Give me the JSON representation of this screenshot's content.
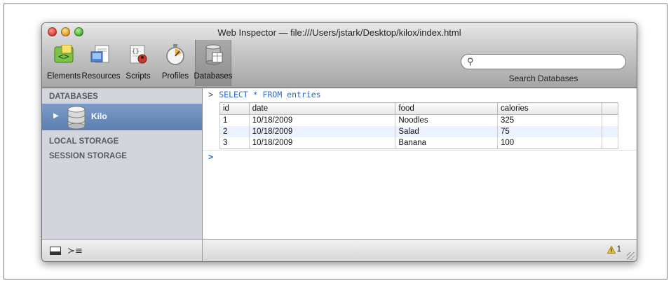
{
  "window": {
    "title": "Web Inspector — file:///Users/jstark/Desktop/kilox/index.html"
  },
  "toolbar": {
    "items": [
      {
        "label": "Elements",
        "icon": "elements-icon"
      },
      {
        "label": "Resources",
        "icon": "resources-icon"
      },
      {
        "label": "Scripts",
        "icon": "scripts-icon"
      },
      {
        "label": "Profiles",
        "icon": "profiles-icon"
      },
      {
        "label": "Databases",
        "icon": "databases-icon",
        "active": true
      }
    ],
    "search_label": "Search Databases"
  },
  "sidebar": {
    "databases_header": "DATABASES",
    "selected_db": "Kilo",
    "local_storage": "LOCAL STORAGE",
    "session_storage": "SESSION STORAGE"
  },
  "console": {
    "prompt": ">",
    "query": "SELECT * FROM entries",
    "columns": [
      "id",
      "date",
      "food",
      "calories"
    ],
    "rows": [
      [
        "1",
        "10/18/2009",
        "Noodles",
        "325"
      ],
      [
        "2",
        "10/18/2009",
        "Salad",
        "75"
      ],
      [
        "3",
        "10/18/2009",
        "Banana",
        "100"
      ]
    ],
    "input_prompt": ">"
  },
  "status": {
    "warning_count": "1"
  },
  "colors": {
    "selection": "#6a8ab9",
    "query_text": "#2f67c8",
    "traffic_close": "#e0443e",
    "traffic_min": "#e5a326",
    "traffic_max": "#55b540"
  }
}
